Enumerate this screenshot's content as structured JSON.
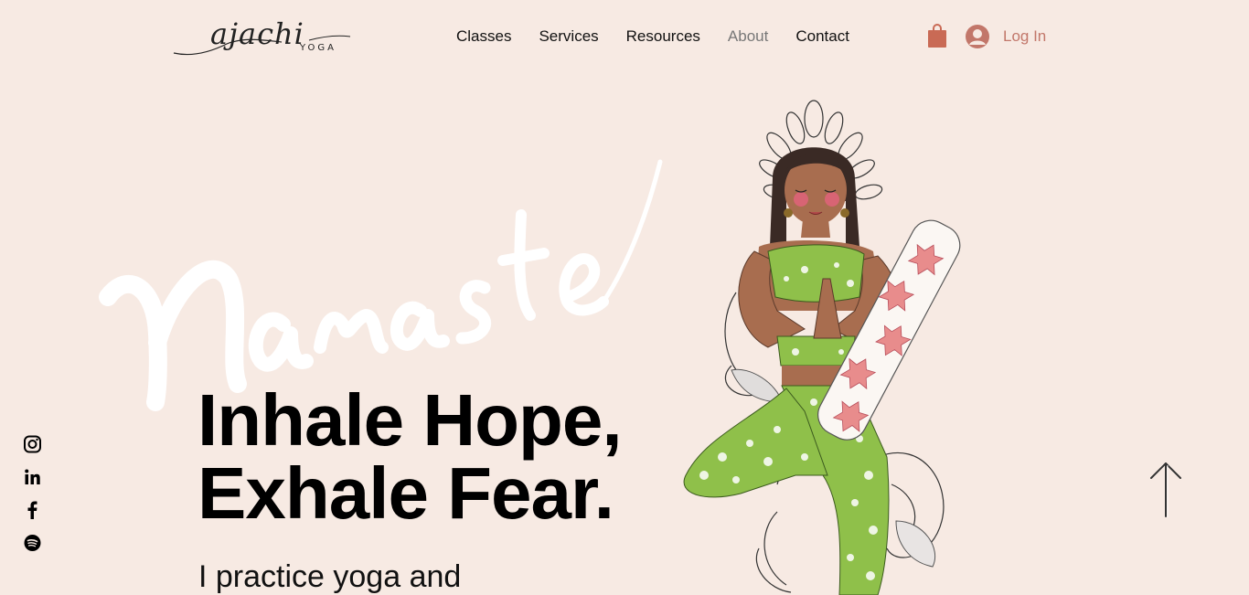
{
  "header": {
    "logo": {
      "script": "ajachi",
      "sub": "YOGA"
    },
    "nav": [
      {
        "label": "Classes"
      },
      {
        "label": "Services"
      },
      {
        "label": "Resources"
      },
      {
        "label": "About"
      },
      {
        "label": "Contact"
      }
    ],
    "active_nav": "About",
    "cart_icon": "shopping-bag-icon",
    "login": {
      "label": "Log In",
      "icon": "user-avatar-icon"
    }
  },
  "hero": {
    "background_word": "Namaste",
    "headline_line1": "Inhale Hope,",
    "headline_line2": "Exhale Fear.",
    "subtext": "I practice yoga and"
  },
  "social": [
    {
      "icon": "instagram-icon"
    },
    {
      "icon": "linkedin-icon"
    },
    {
      "icon": "facebook-icon"
    },
    {
      "icon": "spotify-icon"
    }
  ],
  "scroll_top_icon": "arrow-up-icon",
  "colors": {
    "background": "#f7eae3",
    "accent": "#c2776a",
    "text": "#000000",
    "nav_active": "#777777",
    "cart": "#c96a55",
    "outfit_green": "#8fc04a",
    "mat_pink": "#e88c8c"
  }
}
